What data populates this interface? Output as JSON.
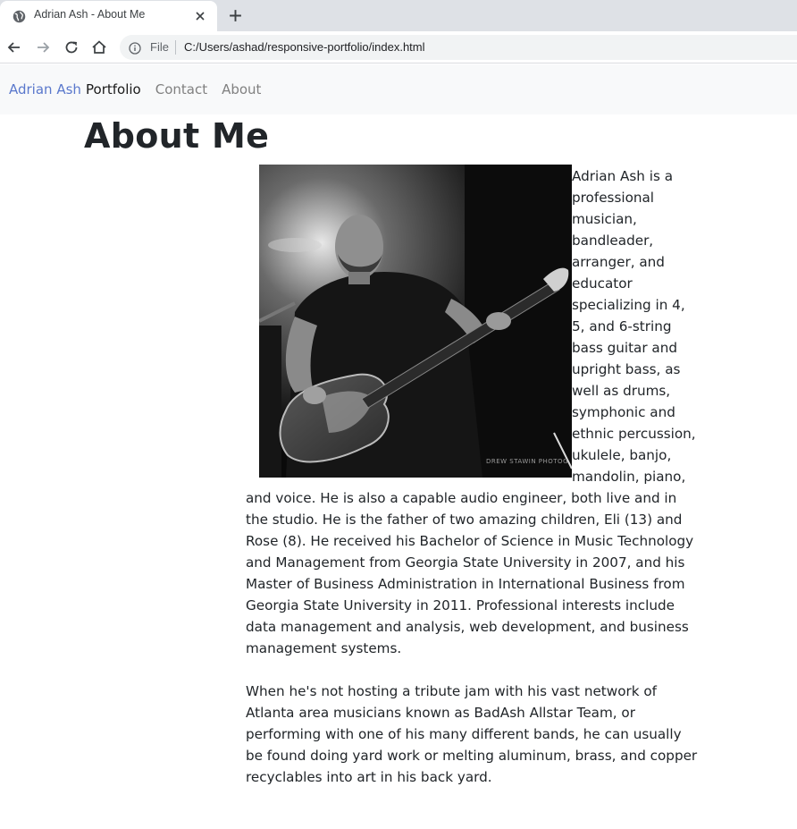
{
  "browser": {
    "tab_title": "Adrian Ash - About Me",
    "scheme_label": "File",
    "url": "C:/Users/ashad/responsive-portfolio/index.html"
  },
  "navbar": {
    "brand": "Adrian Ash",
    "links": [
      {
        "label": "Portfolio",
        "active": true
      },
      {
        "label": "Contact",
        "active": false
      },
      {
        "label": "About",
        "active": false
      }
    ]
  },
  "page": {
    "title": "About Me",
    "photo_watermark": "DREW STAWIN PHOTOG",
    "paragraph1": "Adrian Ash is a professional musician, bandleader, arranger, and educator specializing in 4, 5, and 6-string bass guitar and upright bass, as well as drums, symphonic and ethnic percussion, ukulele, banjo, mandolin, piano, and voice. He is also a capable audio engineer, both live and in the studio. He is the father of two amazing children, Eli (13) and Rose (8). He received his Bachelor of Science in Music Technology and Management from Georgia State University in 2007, and his Master of Business Administration in International Business from Georgia State University in 2011. Professional interests include data management and analysis, web development, and business management systems.",
    "paragraph2": "When he's not hosting a tribute jam with his vast network of Atlanta area musicians known as BadAsh Allstar Team, or performing with one of his many different bands, he can usually be found doing yard work or melting aluminum, brass, and copper recyclables into art in his back yard."
  },
  "colors": {
    "brand": "#5a78cc",
    "navbar_bg": "#f8f9fa",
    "tabstrip_bg": "#dee1e6",
    "text": "#212529"
  }
}
